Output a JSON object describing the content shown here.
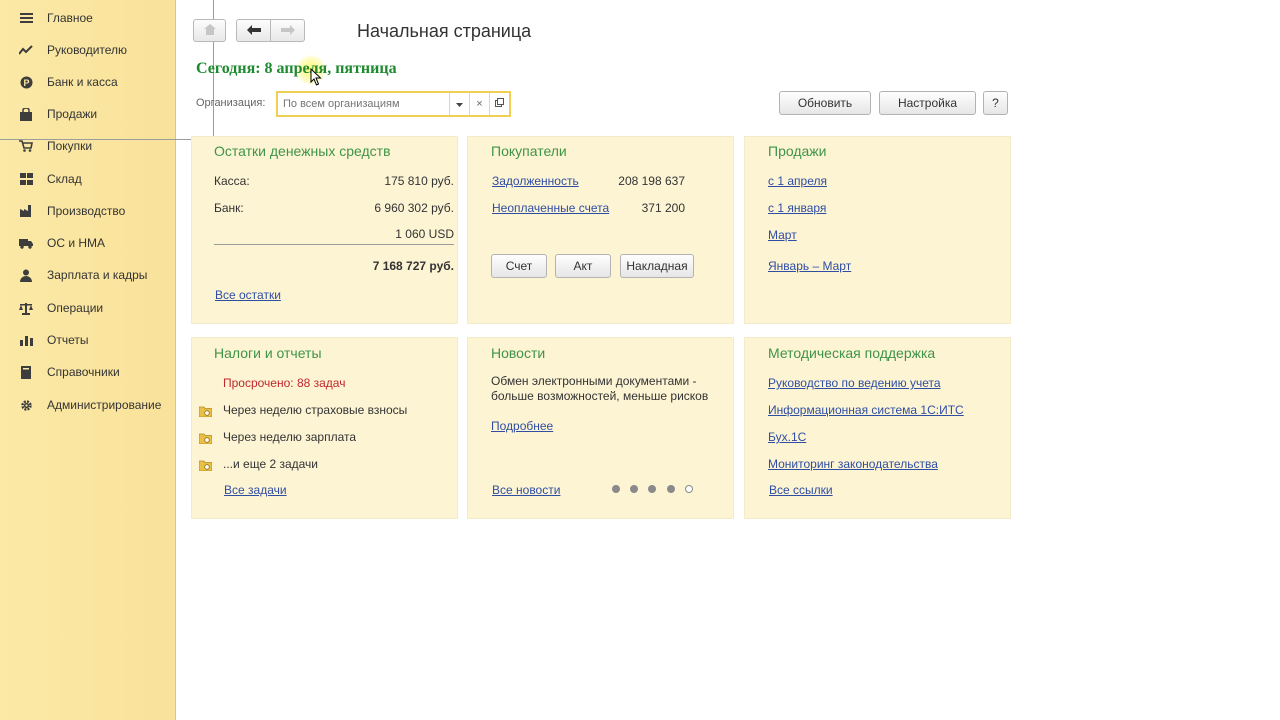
{
  "sidebar": {
    "items": [
      {
        "label": "Главное",
        "icon": "menu-lines-icon"
      },
      {
        "label": "Руководителю",
        "icon": "trend-chart-icon"
      },
      {
        "label": "Банк и касса",
        "icon": "coin-icon"
      },
      {
        "label": "Продажи",
        "icon": "shopping-bag-icon"
      },
      {
        "label": "Покупки",
        "icon": "cart-icon"
      },
      {
        "label": "Склад",
        "icon": "warehouse-grid-icon"
      },
      {
        "label": "Производство",
        "icon": "factory-icon"
      },
      {
        "label": "ОС и НМА",
        "icon": "truck-icon"
      },
      {
        "label": "Зарплата и кадры",
        "icon": "person-icon"
      },
      {
        "label": "Операции",
        "icon": "scales-icon"
      },
      {
        "label": "Отчеты",
        "icon": "bar-chart-icon"
      },
      {
        "label": "Справочники",
        "icon": "book-icon"
      },
      {
        "label": "Администрирование",
        "icon": "gear-icon"
      }
    ]
  },
  "header": {
    "title": "Начальная страница",
    "today": "Сегодня: 8 апреля, пятница"
  },
  "filter": {
    "org_label": "Организация:",
    "org_placeholder": "По всем организациям",
    "refresh_label": "Обновить",
    "settings_label": "Настройка",
    "help_label": "?"
  },
  "cash": {
    "title": "Остатки денежных средств",
    "kassa_label": "Касса:",
    "kassa_value": "175 810 руб.",
    "bank_label": "Банк:",
    "bank_value": "6 960 302 руб.",
    "usd_value": "1 060 USD",
    "total_value": "7 168 727 руб.",
    "all_link": "Все остатки"
  },
  "buyers": {
    "title": "Покупатели",
    "debt_link": "Задолженность",
    "debt_value": "208 198 637",
    "unpaid_link": "Неоплаченные счета",
    "unpaid_value": "371 200",
    "btn_invoice": "Счет",
    "btn_act": "Акт",
    "btn_waybill": "Накладная"
  },
  "sales": {
    "title": "Продажи",
    "links": [
      "с 1 апреля",
      "с 1 января",
      "Март",
      "Январь – Март"
    ]
  },
  "taxes": {
    "title": "Налоги и отчеты",
    "overdue": "Просрочено: 88 задач",
    "tasks": [
      "Через неделю страховые взносы",
      "Через неделю зарплата",
      "...и еще 2 задачи"
    ],
    "all_link": "Все задачи"
  },
  "news": {
    "title": "Новости",
    "line1": "Обмен электронными документами -",
    "line2": "больше возможностей, меньше рисков",
    "more_link": "Подробнее",
    "all_link": "Все новости",
    "pages": 5,
    "current_page": 5
  },
  "support": {
    "title": "Методическая поддержка",
    "links": [
      "Руководство по ведению учета",
      "Информационная система 1С:ИТС",
      "Бух.1С",
      "Мониторинг законодательства"
    ],
    "all_link": "Все ссылки"
  },
  "colors": {
    "accent_green": "#3f9448",
    "today_green": "#1d8a2e",
    "link_blue": "#2f4ea3",
    "overdue_red": "#c2272d",
    "panel_bg": "#fdf4d4",
    "sidebar_bg": "#fbe9a6"
  }
}
